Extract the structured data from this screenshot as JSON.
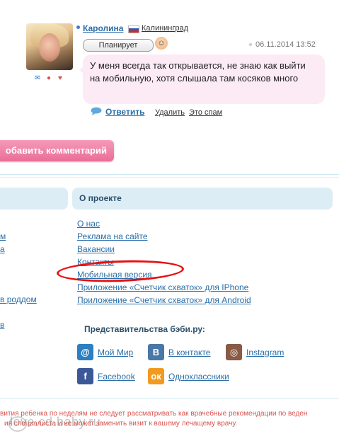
{
  "comment": {
    "username": "Каролина",
    "city": "Калининград",
    "status": "Планирует",
    "date": "06.11.2014 13:52",
    "text": "У меня всегда так открывается, не знаю как выйти на мобильную, хотя слышала там косяков много",
    "reply_label": "Ответить",
    "delete_label": "Удалить",
    "spam_label": "Это спам",
    "icons": [
      "envelope-icon",
      "gift-icon",
      "heart-icon"
    ]
  },
  "add_comment_label": "обавить комментарий",
  "about": {
    "title": "О проекте",
    "links": [
      "О нас",
      "Реклама на сайте",
      "Вакансии",
      "Контакты",
      "Мобильная версия",
      "Приложение «Счетчик схваток» для IPhone",
      "Приложение «Счетчик схваток» для Android"
    ]
  },
  "left_column": {
    "fragments": [
      "м",
      "а",
      "в роддом",
      "в"
    ]
  },
  "representations": {
    "title": "Представительства бэби.ру:",
    "items": [
      {
        "label": "Мой Мир",
        "icon": "mail-ru-icon",
        "color": "#2d7fc1"
      },
      {
        "label": "В контакте",
        "icon": "vk-icon",
        "color": "#4a76a8"
      },
      {
        "label": "Instagram",
        "icon": "instagram-icon",
        "color": "#8a5a44"
      },
      {
        "label": "Facebook",
        "icon": "facebook-icon",
        "color": "#3b5998"
      },
      {
        "label": "Одноклассники",
        "icon": "odnoklassniki-icon",
        "color": "#f29a1f"
      }
    ]
  },
  "disclaimer": "вития ребенка по неделям не следует рассматривать как врачебные рекомендации по веден",
  "disclaimer_line2": "ия специалиста и не может заменить визит к вашему лечащему врачу.",
  "watermark": "love.cd.baby.ru",
  "colors": {
    "link": "#2b6ea8",
    "pink_button": "#e96d98",
    "bubble": "#fcebf4",
    "section_head": "#dcedf5",
    "highlight": "#e81010"
  }
}
